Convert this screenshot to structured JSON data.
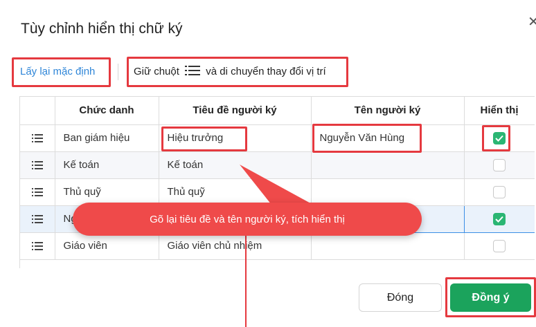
{
  "dialog": {
    "title": "Tùy chỉnh hiển thị chữ ký",
    "close_icon": "close-icon"
  },
  "toolbar": {
    "reset_label": "Lấy lại mặc định",
    "hint_before": "Giữ chuột",
    "hint_icon": "drag-handle-icon",
    "hint_after": "và di chuyển thay đổi vị trí"
  },
  "table": {
    "headers": [
      "Chức danh",
      "Tiêu đề người ký",
      "Tên người ký",
      "Hiển thị"
    ],
    "rows": [
      {
        "position": "Ban giám hiệu",
        "title": "Hiệu trưởng",
        "name": "Nguyễn Văn Hùng",
        "visible": true
      },
      {
        "position": "Kế toán",
        "title": "Kế toán",
        "name": "",
        "visible": false
      },
      {
        "position": "Thủ quỹ",
        "title": "Thủ quỹ",
        "name": "",
        "visible": false
      },
      {
        "position": "Ng",
        "title": "",
        "name": "",
        "visible": true
      },
      {
        "position": "Giáo viên",
        "title": "Giáo viên chủ nhiệm",
        "name": "",
        "visible": false
      }
    ]
  },
  "tooltip": {
    "text": "Gõ lại tiêu đề và tên người ký, tích hiển thị"
  },
  "footer": {
    "close_label": "Đóng",
    "ok_label": "Đồng ý"
  },
  "colors": {
    "accent": "#1ba35c",
    "link": "#2f86d8",
    "highlight": "#e5393f",
    "tooltip": "#ef4a4a"
  }
}
